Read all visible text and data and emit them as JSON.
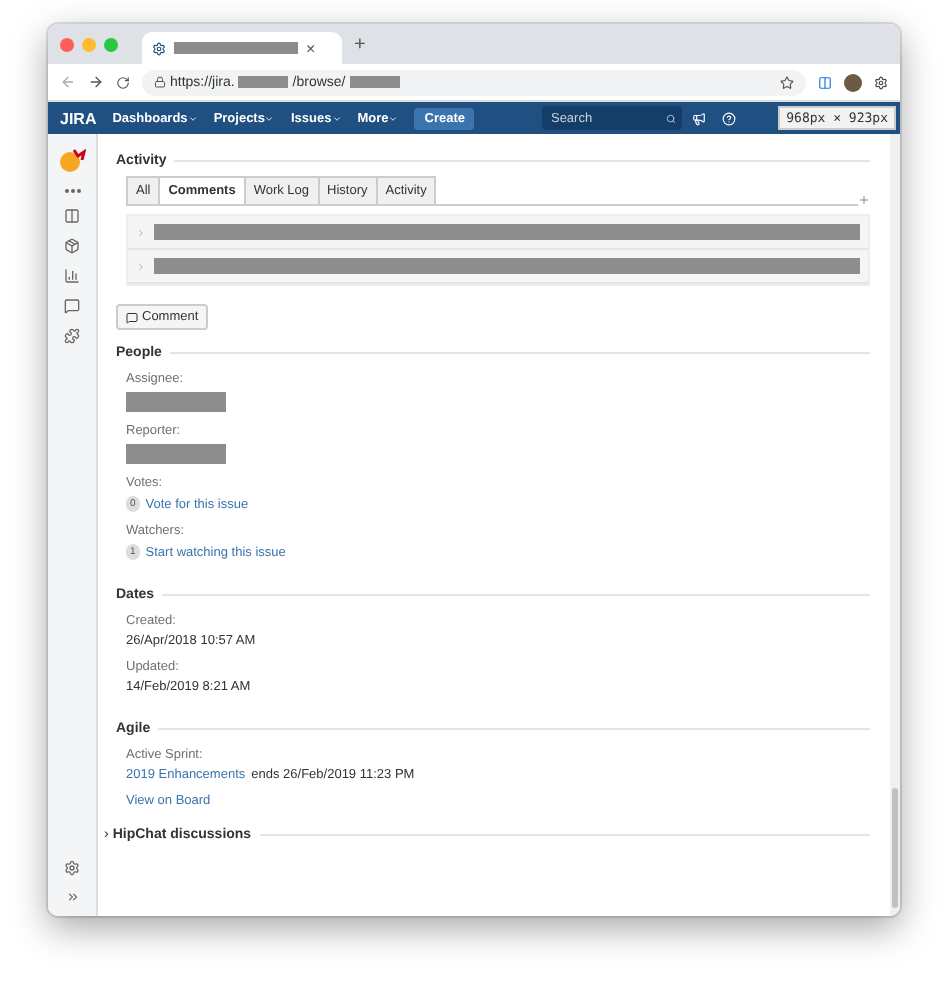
{
  "browser": {
    "tab_close": "×",
    "new_tab": "+",
    "url_parts": [
      {
        "kind": "text",
        "text": "https://jira."
      },
      {
        "kind": "redacted"
      },
      {
        "kind": "text",
        "text": "/browse/"
      },
      {
        "kind": "redacted"
      }
    ],
    "size_tooltip": "968px  ×  923px"
  },
  "nav": {
    "logo": "JIRA",
    "menus": [
      "Dashboards",
      "Projects",
      "Issues",
      "More"
    ],
    "create": "Create",
    "search": {
      "placeholder": "Search"
    }
  },
  "activity": {
    "title": "Activity",
    "tabs": [
      {
        "label": "All",
        "selected": false
      },
      {
        "label": "Comments",
        "selected": true
      },
      {
        "label": "Work Log",
        "selected": false
      },
      {
        "label": "History",
        "selected": false
      },
      {
        "label": "Activity",
        "selected": false
      }
    ],
    "comments": [
      {
        "kind": "redacted"
      },
      {
        "kind": "redacted"
      }
    ],
    "comment_button": "Comment"
  },
  "people": {
    "title": "People",
    "fields": [
      {
        "label": "Assignee:",
        "kind": "redacted"
      },
      {
        "label": "Reporter:",
        "kind": "redacted"
      },
      {
        "label": "Votes:",
        "kind": "count",
        "count": "0",
        "link": "Vote for this issue"
      },
      {
        "label": "Watchers:",
        "kind": "count",
        "count": "1",
        "link": "Start watching this issue"
      }
    ]
  },
  "dates": {
    "title": "Dates",
    "fields": [
      {
        "label": "Created:",
        "value": "26/Apr/2018 10:57 AM"
      },
      {
        "label": "Updated:",
        "value": "14/Feb/2019 8:21 AM"
      }
    ]
  },
  "agile": {
    "title": "Agile",
    "label": "Active Sprint:",
    "sprint_link": "2019 Enhancements",
    "sprint_text": "ends 26/Feb/2019 11:23 PM",
    "board_link": "View on Board"
  },
  "hipchat": {
    "title": "HipChat discussions",
    "expanded": false,
    "marker": "›"
  }
}
